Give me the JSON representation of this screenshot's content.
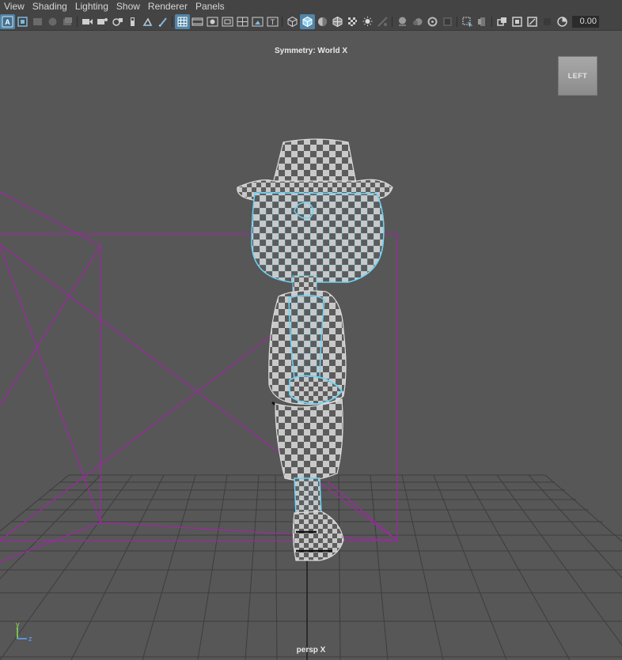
{
  "menubar": {
    "items": [
      {
        "label": "View"
      },
      {
        "label": "Shading"
      },
      {
        "label": "Lighting"
      },
      {
        "label": "Show"
      },
      {
        "label": "Renderer"
      },
      {
        "label": "Panels"
      }
    ]
  },
  "toolbar": {
    "value": "0.00",
    "icons": [
      "select-camera-icon",
      "camera-attributes-icon",
      "bookmarks-icon",
      "image-plane-icon",
      "grease-pencil-icon",
      "2d-pan-zoom-icon",
      "film-gate-icon",
      "resolution-gate-icon",
      "gate-mask-icon",
      "field-chart-icon",
      "safe-action-icon",
      "safe-title-icon",
      "wireframe-icon",
      "smooth-shade-icon",
      "default-material-icon",
      "wireframe-on-shaded-icon",
      "textured-icon",
      "lights-icon",
      "shadows-icon",
      "screen-space-ao-icon",
      "motion-blur-icon",
      "anti-aliasing-icon",
      "depth-of-field-icon",
      "isolate-select-icon",
      "xray-icon",
      "xray-joints-icon",
      "xray-components-icon",
      "exposure-icon"
    ]
  },
  "viewport": {
    "symmetry_label": "Symmetry: World X",
    "viewcube_label": "LEFT",
    "camera_label": "persp X",
    "axis": {
      "y": "y",
      "z": "z"
    }
  },
  "colors": {
    "viewport_bg": "#575757",
    "grid": "#3c3c3c",
    "wire_cyan": "#66ccee",
    "bounding_magenta": "#9b2aa0",
    "active_icon": "#5285a6"
  }
}
